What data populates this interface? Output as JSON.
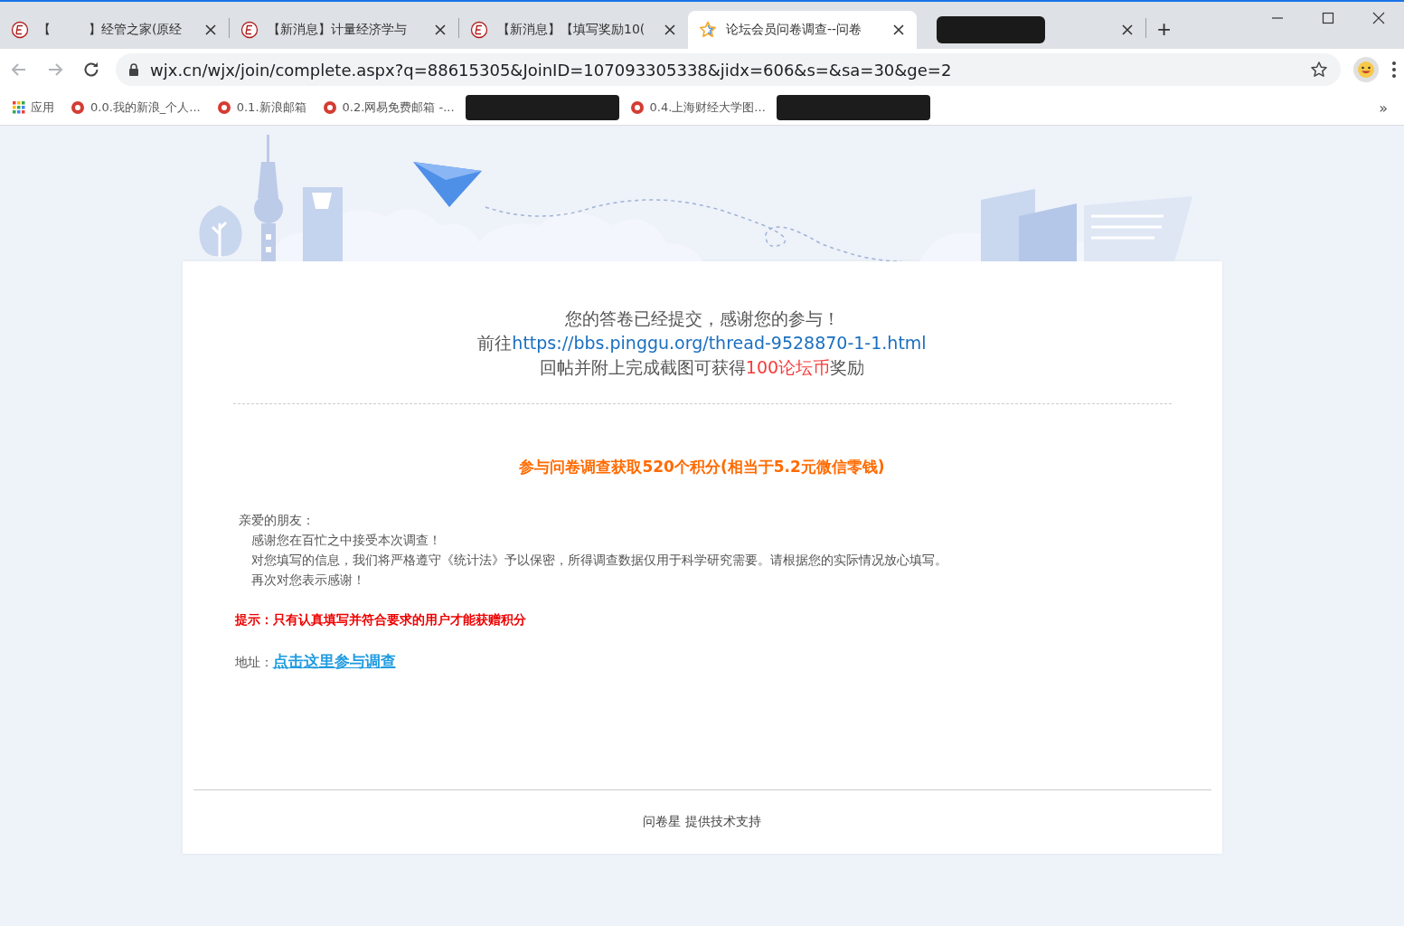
{
  "tabs": [
    {
      "kind": "forum",
      "title": "【　　　】经管之家(原经",
      "selected": false
    },
    {
      "kind": "forum",
      "title": "【新消息】计量经济学与",
      "selected": false
    },
    {
      "kind": "forum",
      "title": "【新消息】【填写奖励10(",
      "selected": false
    },
    {
      "kind": "survey",
      "title": "论坛会员问卷调查--问卷",
      "selected": true
    },
    {
      "kind": "redacted",
      "selected": false
    }
  ],
  "new_tab": "+",
  "address": "wjx.cn/wjx/join/complete.aspx?q=88615305&JoinID=107093305338&jidx=606&s=&sa=30&ge=2",
  "bookmarks": [
    {
      "kind": "apps",
      "label": "应用"
    },
    {
      "kind": "link",
      "label": "0.0.我的新浪_个人..."
    },
    {
      "kind": "link",
      "label": "0.1.新浪邮箱"
    },
    {
      "kind": "link",
      "label": "0.2.网易免费邮箱 -..."
    },
    {
      "kind": "redacted"
    },
    {
      "kind": "link",
      "label": "0.4.上海财经大学图..."
    },
    {
      "kind": "redacted"
    }
  ],
  "bookmarks_overflow": "»",
  "card": {
    "title": "您的答卷已经提交，感谢您的参与！",
    "link_prefix": "前往",
    "link": "https://bbs.pinggu.org/thread-9528870-1-1.html",
    "reward_prefix": "回帖并附上完成截图可获得",
    "reward_highlight": "100论坛币",
    "reward_suffix": "奖励",
    "promo": "参与问卷调查获取520个积分(相当于5.2元微信零钱)",
    "greeting": "亲爱的朋友：",
    "paragraphs": [
      "感谢您在百忙之中接受本次调查！",
      "对您填写的信息，我们将严格遵守《统计法》予以保密，所得调查数据仅用于科学研究需要。请根据您的实际情况放心填写。",
      "再次对您表示感谢！"
    ],
    "tip": "提示：只有认真填写并符合要求的用户才能获赠积分",
    "address_label": "地址：",
    "address_link": "点击这里参与调查",
    "footer": "问卷星 提供技术支持"
  }
}
